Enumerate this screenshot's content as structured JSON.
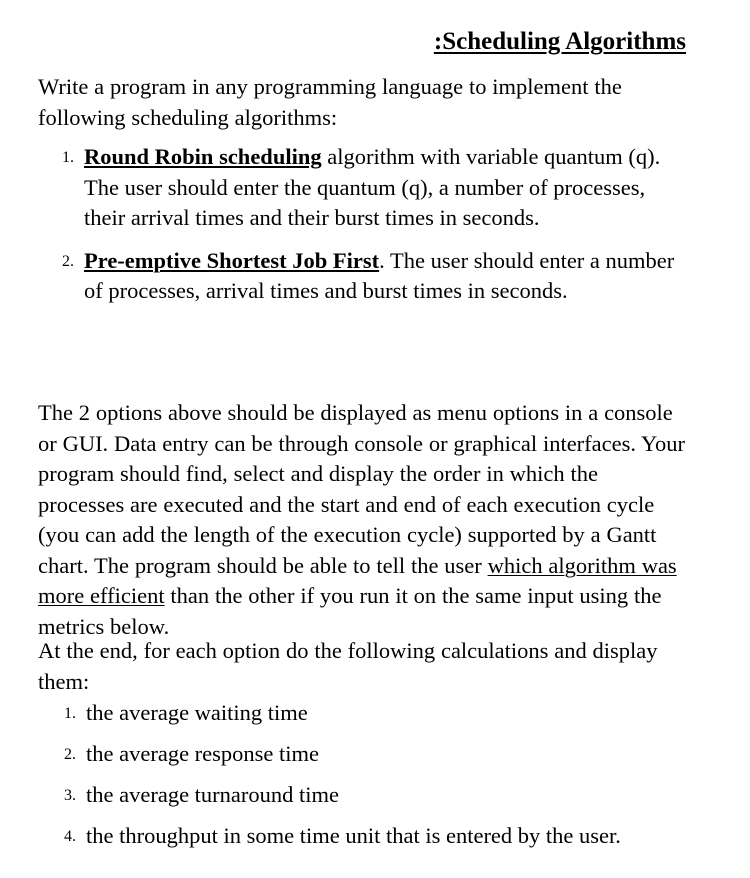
{
  "document": {
    "title": ":Scheduling Algorithms",
    "background_color": "#ffffff",
    "text_color": "#000000"
  },
  "intro": {
    "text": "Write a program in any programming language to implement the following scheduling algorithms:"
  },
  "algorithms_list": {
    "items": [
      {
        "marker": "1.",
        "heading": "Round Robin scheduling",
        "body": " algorithm with variable quantum (q). The user should enter the quantum (q), a number of processes, their arrival times and their burst times in seconds."
      },
      {
        "marker": "2.",
        "heading": "Pre-emptive Shortest Job First",
        "body": ". The user should enter a number of processes, arrival times and burst times in seconds."
      }
    ]
  },
  "description": {
    "part1": "The 2 options above should be displayed as menu options in a console or GUI. Data entry can be through console or graphical interfaces. Your program should find, select and display the order in which the processes are executed and the start and end of each execution cycle (you can add the length of the execution cycle) supported by a Gantt chart. The program should be able to tell the user ",
    "underlined_phrase": "which algorithm was more efficient",
    "part2": " than the other if you run it on the same input using the metrics below."
  },
  "calculations_intro": {
    "text": "At the end, for each option do the following calculations and display them:"
  },
  "metrics_list": {
    "items": [
      {
        "marker": "1.",
        "text": "the average waiting time"
      },
      {
        "marker": "2.",
        "text": "the average response time"
      },
      {
        "marker": "3.",
        "text": "the average turnaround time"
      },
      {
        "marker": "4.",
        "text": "the throughput in some time unit that is entered by the user."
      }
    ]
  }
}
